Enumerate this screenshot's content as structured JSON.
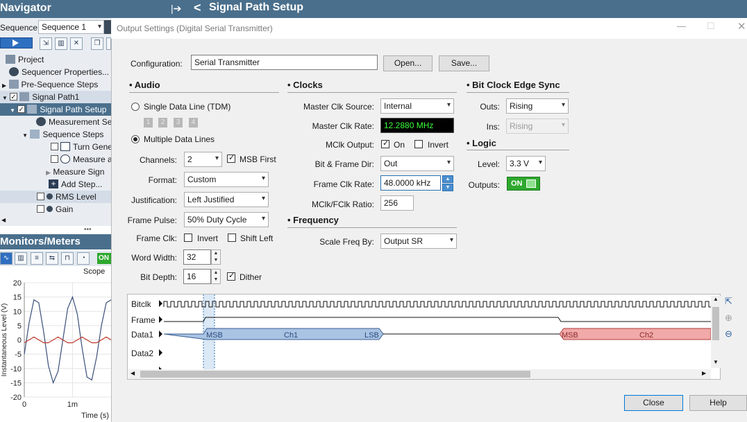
{
  "navigator": {
    "title": "Navigator",
    "sequence_label": "Sequence:",
    "sequence_value": "Sequence 1",
    "tree": [
      {
        "label": "Project",
        "level": 0
      },
      {
        "label": "Sequencer Properties...",
        "level": 1
      },
      {
        "label": "Pre-Sequence Steps",
        "level": 0
      },
      {
        "label": "Signal Path1",
        "level": 0
      },
      {
        "label": "Signal Path Setup",
        "level": 1
      },
      {
        "label": "Measurement Se",
        "level": 2
      },
      {
        "label": "Sequence Steps",
        "level": 2
      },
      {
        "label": "Turn Gene",
        "level": 3
      },
      {
        "label": "Measure a",
        "level": 3
      },
      {
        "label": "Measure Sign",
        "level": 3
      },
      {
        "label": "Add Step...",
        "level": 3
      },
      {
        "label": "RMS Level",
        "level": 2
      },
      {
        "label": "Gain",
        "level": 2
      }
    ]
  },
  "header": {
    "title": "Signal Path Setup"
  },
  "monitors": {
    "title": "Monitors/Meters",
    "on_label": "ON",
    "scope": {
      "title": "Scope",
      "ylabel": "Instantaneous Level (V)",
      "xlabel": "Time (s)",
      "yticks": [
        "20",
        "15",
        "10",
        "5",
        "0",
        "-5",
        "-10",
        "-15",
        "-20"
      ],
      "xticks": [
        "0",
        "1m"
      ]
    }
  },
  "chart_data": {
    "type": "line",
    "title": "Scope",
    "xlabel": "Time (s)",
    "ylabel": "Instantaneous Level (V)",
    "ylim": [
      -20,
      20
    ],
    "x": [
      0,
      0.0001,
      0.0002,
      0.0003,
      0.0004,
      0.0005,
      0.0006,
      0.0007,
      0.0008,
      0.0009,
      0.001,
      0.0011,
      0.0012,
      0.0013,
      0.0014,
      0.0015,
      0.0016,
      0.0017,
      0.0018
    ],
    "series": [
      {
        "values": [
          -5,
          6,
          14,
          13,
          3,
          -9,
          -15,
          -11,
          0,
          11,
          15,
          9,
          -3,
          -13,
          -14,
          -6,
          5,
          13,
          14
        ],
        "color": "#3a4f7a"
      },
      {
        "values": [
          -1,
          0,
          1,
          0,
          -1,
          -1,
          0,
          1,
          0,
          -1,
          -1,
          0,
          1,
          0,
          -1,
          -1,
          0,
          1,
          0
        ],
        "color": "#c0392b"
      }
    ],
    "grid": true
  },
  "dialog": {
    "title": "Output Settings (Digital Serial Transmitter)",
    "configuration_label": "Configuration:",
    "configuration_value": "Serial Transmitter",
    "open_button": "Open...",
    "save_button": "Save...",
    "audio": {
      "title": "Audio",
      "single_line": "Single Data Line (TDM)",
      "slots": [
        "1",
        "2",
        "3",
        "4"
      ],
      "multiple_lines": "Multiple Data Lines",
      "channels_label": "Channels:",
      "channels_value": "2",
      "msb_first": "MSB First",
      "format_label": "Format:",
      "format_value": "Custom",
      "justification_label": "Justification:",
      "justification_value": "Left Justified",
      "frame_pulse_label": "Frame Pulse:",
      "frame_pulse_value": "50% Duty Cycle",
      "frame_clk_label": "Frame Clk:",
      "invert": "Invert",
      "shift_left": "Shift Left",
      "word_width_label": "Word Width:",
      "word_width_value": "32",
      "bit_depth_label": "Bit Depth:",
      "bit_depth_value": "16",
      "dither": "Dither"
    },
    "clocks": {
      "title": "Clocks",
      "master_src_label": "Master Clk Source:",
      "master_src_value": "Internal",
      "master_rate_label": "Master Clk Rate:",
      "master_rate_value": "12.2880 MHz",
      "mclk_output_label": "MClk Output:",
      "on": "On",
      "invert": "Invert",
      "bit_frame_dir_label": "Bit & Frame Dir:",
      "bit_frame_dir_value": "Out",
      "frame_rate_label": "Frame Clk Rate:",
      "frame_rate_value": "48.0000 kHz",
      "ratio_label": "MClk/FClk Ratio:",
      "ratio_value": "256"
    },
    "frequency": {
      "title": "Frequency",
      "scale_label": "Scale Freq By:",
      "scale_value": "Output SR"
    },
    "bit_clock": {
      "title": "Bit Clock Edge Sync",
      "outs_label": "Outs:",
      "outs_value": "Rising",
      "ins_label": "Ins:",
      "ins_value": "Rising"
    },
    "logic": {
      "title": "Logic",
      "level_label": "Level:",
      "level_value": "3.3 V",
      "outputs_label": "Outputs:",
      "outputs_value": "ON"
    },
    "timing": {
      "bitclk": "Bitclk",
      "frame": "Frame",
      "data1": "Data1",
      "data2": "Data2",
      "msb": "MSB",
      "ch1": "Ch1",
      "lsb": "LSB",
      "ch2": "Ch2"
    },
    "close_button": "Close",
    "help_button": "Help"
  },
  "colors": {
    "titlebar": "#4a6f8c",
    "accent": "#2f6fc0",
    "on_green": "#2ea82e"
  }
}
